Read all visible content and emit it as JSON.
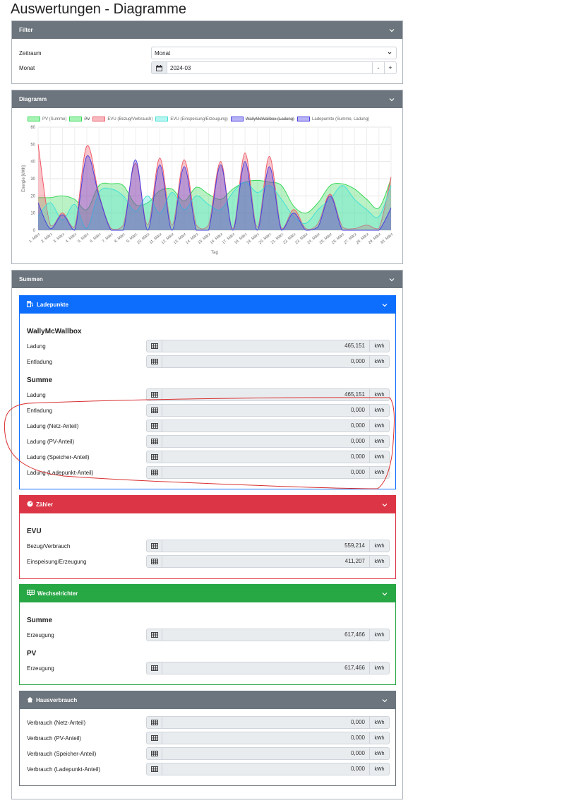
{
  "page": {
    "title": "Auswertungen - Diagramme"
  },
  "filter": {
    "header": "Filter",
    "zeitraum_label": "Zeitraum",
    "zeitraum_value": "Monat",
    "monat_label": "Monat",
    "monat_value": "2024-03",
    "minus": "-",
    "plus": "+"
  },
  "diagramm": {
    "header": "Diagramm",
    "legend": [
      {
        "label": "PV (Summe)",
        "fill": "#a7f3b5",
        "stroke": "#39d95a",
        "strike": false
      },
      {
        "label": "PV",
        "fill": "#a7f3b5",
        "stroke": "#39d95a",
        "strike": true
      },
      {
        "label": "EVU (Bezug/Verbrauch)",
        "fill": "#f7b9bf",
        "stroke": "#ef5b69",
        "strike": false
      },
      {
        "label": "EVU (Einspeisung/Erzeugung)",
        "fill": "#b5f5f0",
        "stroke": "#43e1d6",
        "strike": false
      },
      {
        "label": "WallyMcWallbox (Ladung)",
        "fill": "#b7b3f5",
        "stroke": "#4a3fe0",
        "strike": true
      },
      {
        "label": "Ladepunkte (Summe, Ladung)",
        "fill": "#b7b3f5",
        "stroke": "#4a3fe0",
        "strike": false
      }
    ]
  },
  "chart_data": {
    "type": "area",
    "ylabel": "Energie [kWh]",
    "xlabel": "Tag",
    "ylim": [
      0,
      60
    ],
    "yticks": [
      0,
      10,
      20,
      30,
      40,
      50,
      60
    ],
    "categories": [
      "1. März",
      "2. März",
      "3. März",
      "4. März",
      "5. März",
      "6. März",
      "7. März",
      "8. März",
      "9. März",
      "10. März",
      "11. März",
      "12. März",
      "13. März",
      "14. März",
      "15. März",
      "16. März",
      "17. März",
      "18. März",
      "19. März",
      "20. März",
      "21. März",
      "22. März",
      "23. März",
      "24. März",
      "25. März",
      "26. März",
      "27. März",
      "28. März",
      "29. März",
      "30. März"
    ],
    "series": [
      {
        "name": "PV (Summe)",
        "fill": "rgba(57,217,90,0.35)",
        "stroke": "#39d95a",
        "values": [
          19,
          19,
          20,
          18,
          12,
          26,
          27,
          26,
          15,
          16,
          23,
          24,
          17,
          25,
          21,
          18,
          24,
          28,
          29,
          28,
          26,
          14,
          10,
          16,
          26,
          27,
          24,
          18,
          13,
          30
        ]
      },
      {
        "name": "EVU (Bezug/Verbrauch)",
        "fill": "rgba(239,91,105,0.35)",
        "stroke": "#ef5b69",
        "values": [
          50,
          3,
          10,
          2,
          49,
          21,
          1,
          3,
          39,
          3,
          42,
          3,
          41,
          3,
          3,
          40,
          1,
          45,
          2,
          43,
          1,
          12,
          1,
          4,
          21,
          2,
          1,
          3,
          1,
          31
        ]
      },
      {
        "name": "EVU (Einspeisung/Erzeugung)",
        "fill": "rgba(67,225,214,0.30)",
        "stroke": "#43e1d6",
        "values": [
          8,
          16,
          6,
          15,
          1,
          22,
          24,
          20,
          11,
          20,
          10,
          22,
          12,
          20,
          15,
          12,
          22,
          28,
          22,
          26,
          18,
          8,
          4,
          12,
          18,
          26,
          18,
          12,
          8,
          26
        ]
      },
      {
        "name": "Ladepunkte (Summe, Ladung)",
        "fill": "rgba(74,63,224,0.35)",
        "stroke": "#4a3fe0",
        "values": [
          16,
          1,
          9,
          0,
          43,
          20,
          0,
          0,
          41,
          0,
          38,
          0,
          37,
          0,
          0,
          38,
          0,
          40,
          0,
          37,
          0,
          10,
          0,
          2,
          20,
          0,
          0,
          0,
          0,
          13
        ]
      }
    ]
  },
  "summen": {
    "header": "Summen",
    "ladepunkte": {
      "header": "Ladepunkte",
      "wb_title": "WallyMcWallbox",
      "wb_rows": [
        {
          "label": "Ladung",
          "value": "465,151",
          "unit": "kWh"
        },
        {
          "label": "Entladung",
          "value": "0,000",
          "unit": "kWh"
        }
      ],
      "summe_title": "Summe",
      "summe_rows": [
        {
          "label": "Ladung",
          "value": "465,151",
          "unit": "kWh"
        },
        {
          "label": "Entladung",
          "value": "0,000",
          "unit": "kWh"
        },
        {
          "label": "Ladung (Netz-Anteil)",
          "value": "0,000",
          "unit": "kWh"
        },
        {
          "label": "Ladung (PV-Anteil)",
          "value": "0,000",
          "unit": "kWh"
        },
        {
          "label": "Ladung (Speicher-Anteil)",
          "value": "0,000",
          "unit": "kWh"
        },
        {
          "label": "Ladung (Ladepunkt-Anteil)",
          "value": "0,000",
          "unit": "kWh"
        }
      ]
    },
    "zaehler": {
      "header": "Zähler",
      "evu_title": "EVU",
      "rows": [
        {
          "label": "Bezug/Verbrauch",
          "value": "559,214",
          "unit": "kWh"
        },
        {
          "label": "Einspeisung/Erzeugung",
          "value": "411,207",
          "unit": "kWh"
        }
      ]
    },
    "wechselrichter": {
      "header": "Wechselrichter",
      "summe_title": "Summe",
      "summe_rows": [
        {
          "label": "Erzeugung",
          "value": "617,466",
          "unit": "kWh"
        }
      ],
      "pv_title": "PV",
      "pv_rows": [
        {
          "label": "Erzeugung",
          "value": "617,466",
          "unit": "kWh"
        }
      ]
    },
    "hausverbrauch": {
      "header": "Hausverbrauch",
      "rows": [
        {
          "label": "Verbrauch (Netz-Anteil)",
          "value": "0,000",
          "unit": "kWh"
        },
        {
          "label": "Verbrauch (PV-Anteil)",
          "value": "0,000",
          "unit": "kWh"
        },
        {
          "label": "Verbrauch (Speicher-Anteil)",
          "value": "0,000",
          "unit": "kWh"
        },
        {
          "label": "Verbrauch (Ladepunkt-Anteil)",
          "value": "0,000",
          "unit": "kWh"
        }
      ]
    }
  },
  "colors": {
    "card_header": "#6c757d",
    "ladepunkte": "#0d6efd",
    "zaehler": "#dc3545",
    "wechselrichter": "#28a745",
    "hausverbrauch": "#6c757d",
    "annotation": "#d93030"
  }
}
